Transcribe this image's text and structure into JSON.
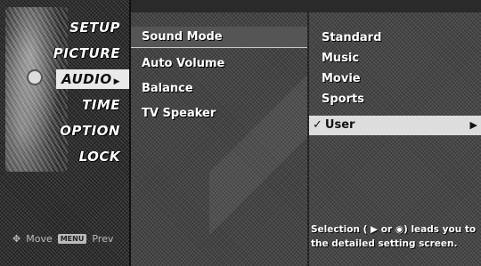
{
  "categories": [
    {
      "label": "SETUP"
    },
    {
      "label": "PICTURE"
    },
    {
      "label": "AUDIO"
    },
    {
      "label": "TIME"
    },
    {
      "label": "OPTION"
    },
    {
      "label": "LOCK"
    }
  ],
  "active_category": "AUDIO",
  "footer": {
    "move_label": "Move",
    "menu_key": "MENU",
    "prev_label": "Prev"
  },
  "options": [
    {
      "label": "Sound Mode"
    },
    {
      "label": "Auto Volume"
    },
    {
      "label": "Balance"
    },
    {
      "label": "TV Speaker"
    }
  ],
  "values": [
    {
      "label": "Standard"
    },
    {
      "label": "Music"
    },
    {
      "label": "Movie"
    },
    {
      "label": "Sports"
    },
    {
      "label": "User"
    }
  ],
  "selected_value_check": "✓",
  "selected_value_arrow": "▶",
  "help": {
    "line1": "Selection ( ▶ or ◉) leads you to",
    "line2": "the detailed setting screen."
  },
  "icons": {
    "move": "dpad-icon",
    "arrow": "right-triangle-icon",
    "check": "check-icon"
  },
  "colors": {
    "highlight": "#dddddd",
    "text": "#ffffff"
  }
}
